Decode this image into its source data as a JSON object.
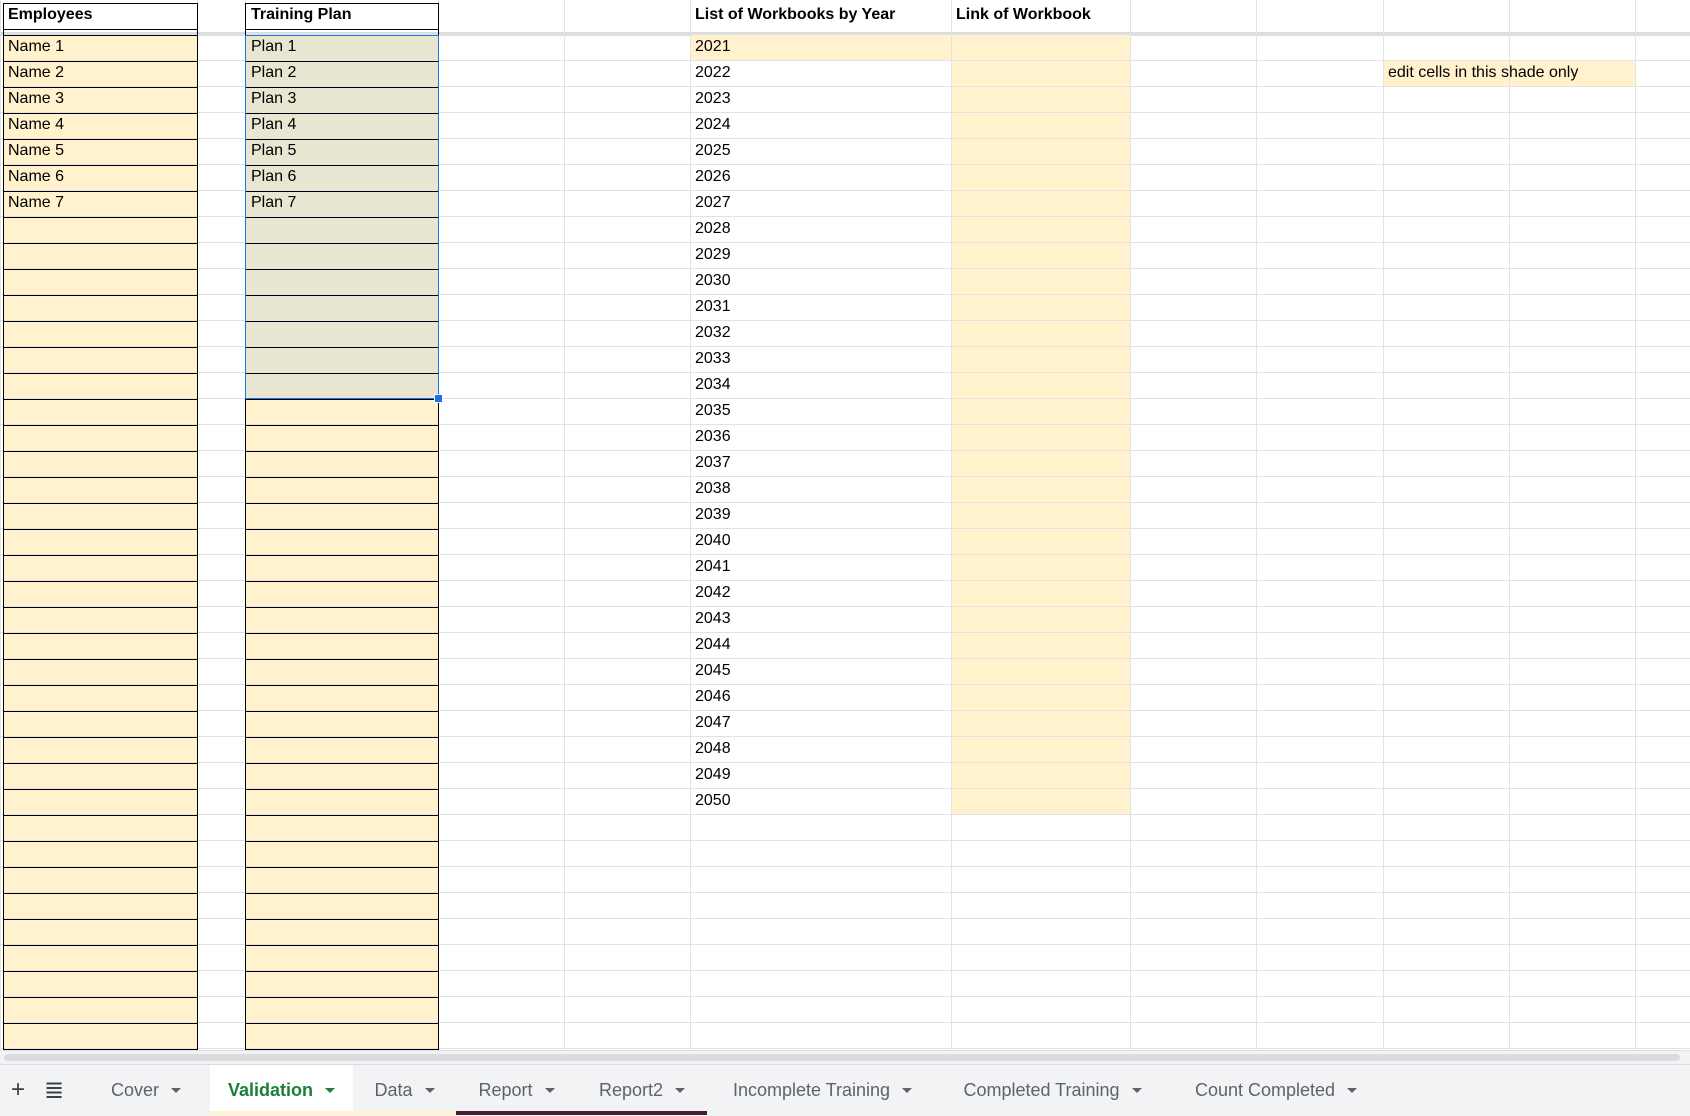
{
  "headers": {
    "employees": "Employees",
    "training_plan": "Training Plan",
    "workbooks_by_year": "List of Workbooks by Year",
    "link_of_workbook": "Link of Workbook"
  },
  "employees": [
    "Name 1",
    "Name 2",
    "Name 3",
    "Name 4",
    "Name 5",
    "Name 6",
    "Name 7"
  ],
  "plans": [
    "Plan 1",
    "Plan 2",
    "Plan 3",
    "Plan 4",
    "Plan 5",
    "Plan 6",
    "Plan 7"
  ],
  "years": [
    "2021",
    "2022",
    "2023",
    "2024",
    "2025",
    "2026",
    "2027",
    "2028",
    "2029",
    "2030",
    "2031",
    "2032",
    "2033",
    "2034",
    "2035",
    "2036",
    "2037",
    "2038",
    "2039",
    "2040",
    "2041",
    "2042",
    "2043",
    "2044",
    "2045",
    "2046",
    "2047",
    "2048",
    "2049",
    "2050"
  ],
  "note": "edit cells in this shade only",
  "tabbar": {
    "add_label": "+",
    "all_sheets_label": "≣",
    "tabs": [
      {
        "label": "Cover",
        "active": false,
        "underline": ""
      },
      {
        "label": "Validation",
        "active": true,
        "underline": "#fff2cc"
      },
      {
        "label": "Data",
        "active": false,
        "underline": "#fff2cc"
      },
      {
        "label": "Report",
        "active": false,
        "underline": "#4a1c30"
      },
      {
        "label": "Report2",
        "active": false,
        "underline": "#4a1c30"
      },
      {
        "label": "Incomplete Training",
        "active": false,
        "underline": ""
      },
      {
        "label": "Completed Training",
        "active": false,
        "underline": ""
      },
      {
        "label": "Count Completed",
        "active": false,
        "underline": ""
      }
    ]
  },
  "colors": {
    "editable_shade": "#fff2cc",
    "selection_fill": "#e8e5d0",
    "selection_border": "#1a73e8",
    "active_tab_text": "#188038"
  }
}
